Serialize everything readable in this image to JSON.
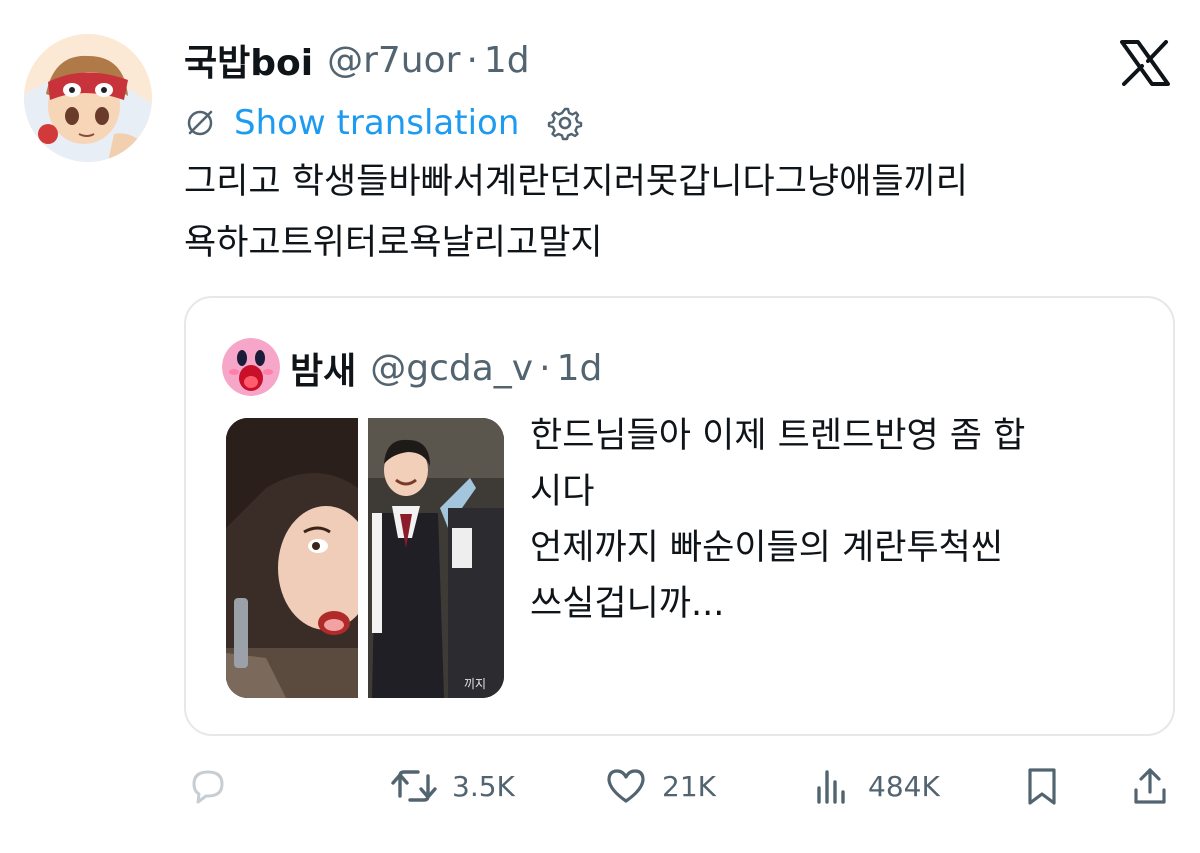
{
  "tweet": {
    "author_name": "국밥boi",
    "author_handle": "@r7uor",
    "separator": "·",
    "time": "1d",
    "translate_label": "Show translation",
    "text_lines": [
      "그리고  학생들바빠서계란던지러못갑니다그냥애들끼리",
      "욕하고트위터로욕날리고말지"
    ]
  },
  "quote": {
    "author_name": "밤새",
    "author_handle": "@gcda_v",
    "separator": "·",
    "time": "1d",
    "text_lines": [
      "한드님들아 이제 트렌드반영 좀 합",
      "시다",
      "언제까지 빠순이들의 계란투척씬",
      "쓰실겁니까..."
    ],
    "image_caption": "끼지"
  },
  "actions": {
    "retweets": "3.5K",
    "likes": "21K",
    "views": "484K"
  },
  "icons": {
    "reply": "reply-icon",
    "retweet": "retweet-icon",
    "like": "heart-icon",
    "views": "views-icon",
    "bookmark": "bookmark-icon",
    "share": "share-icon",
    "platform": "x-logo-icon",
    "settings": "gear-icon",
    "translate": "translate-icon"
  },
  "colors": {
    "link": "#1d9bf0",
    "secondary_text": "#536471",
    "primary_text": "#0f1419",
    "border": "#e4e8eb"
  }
}
